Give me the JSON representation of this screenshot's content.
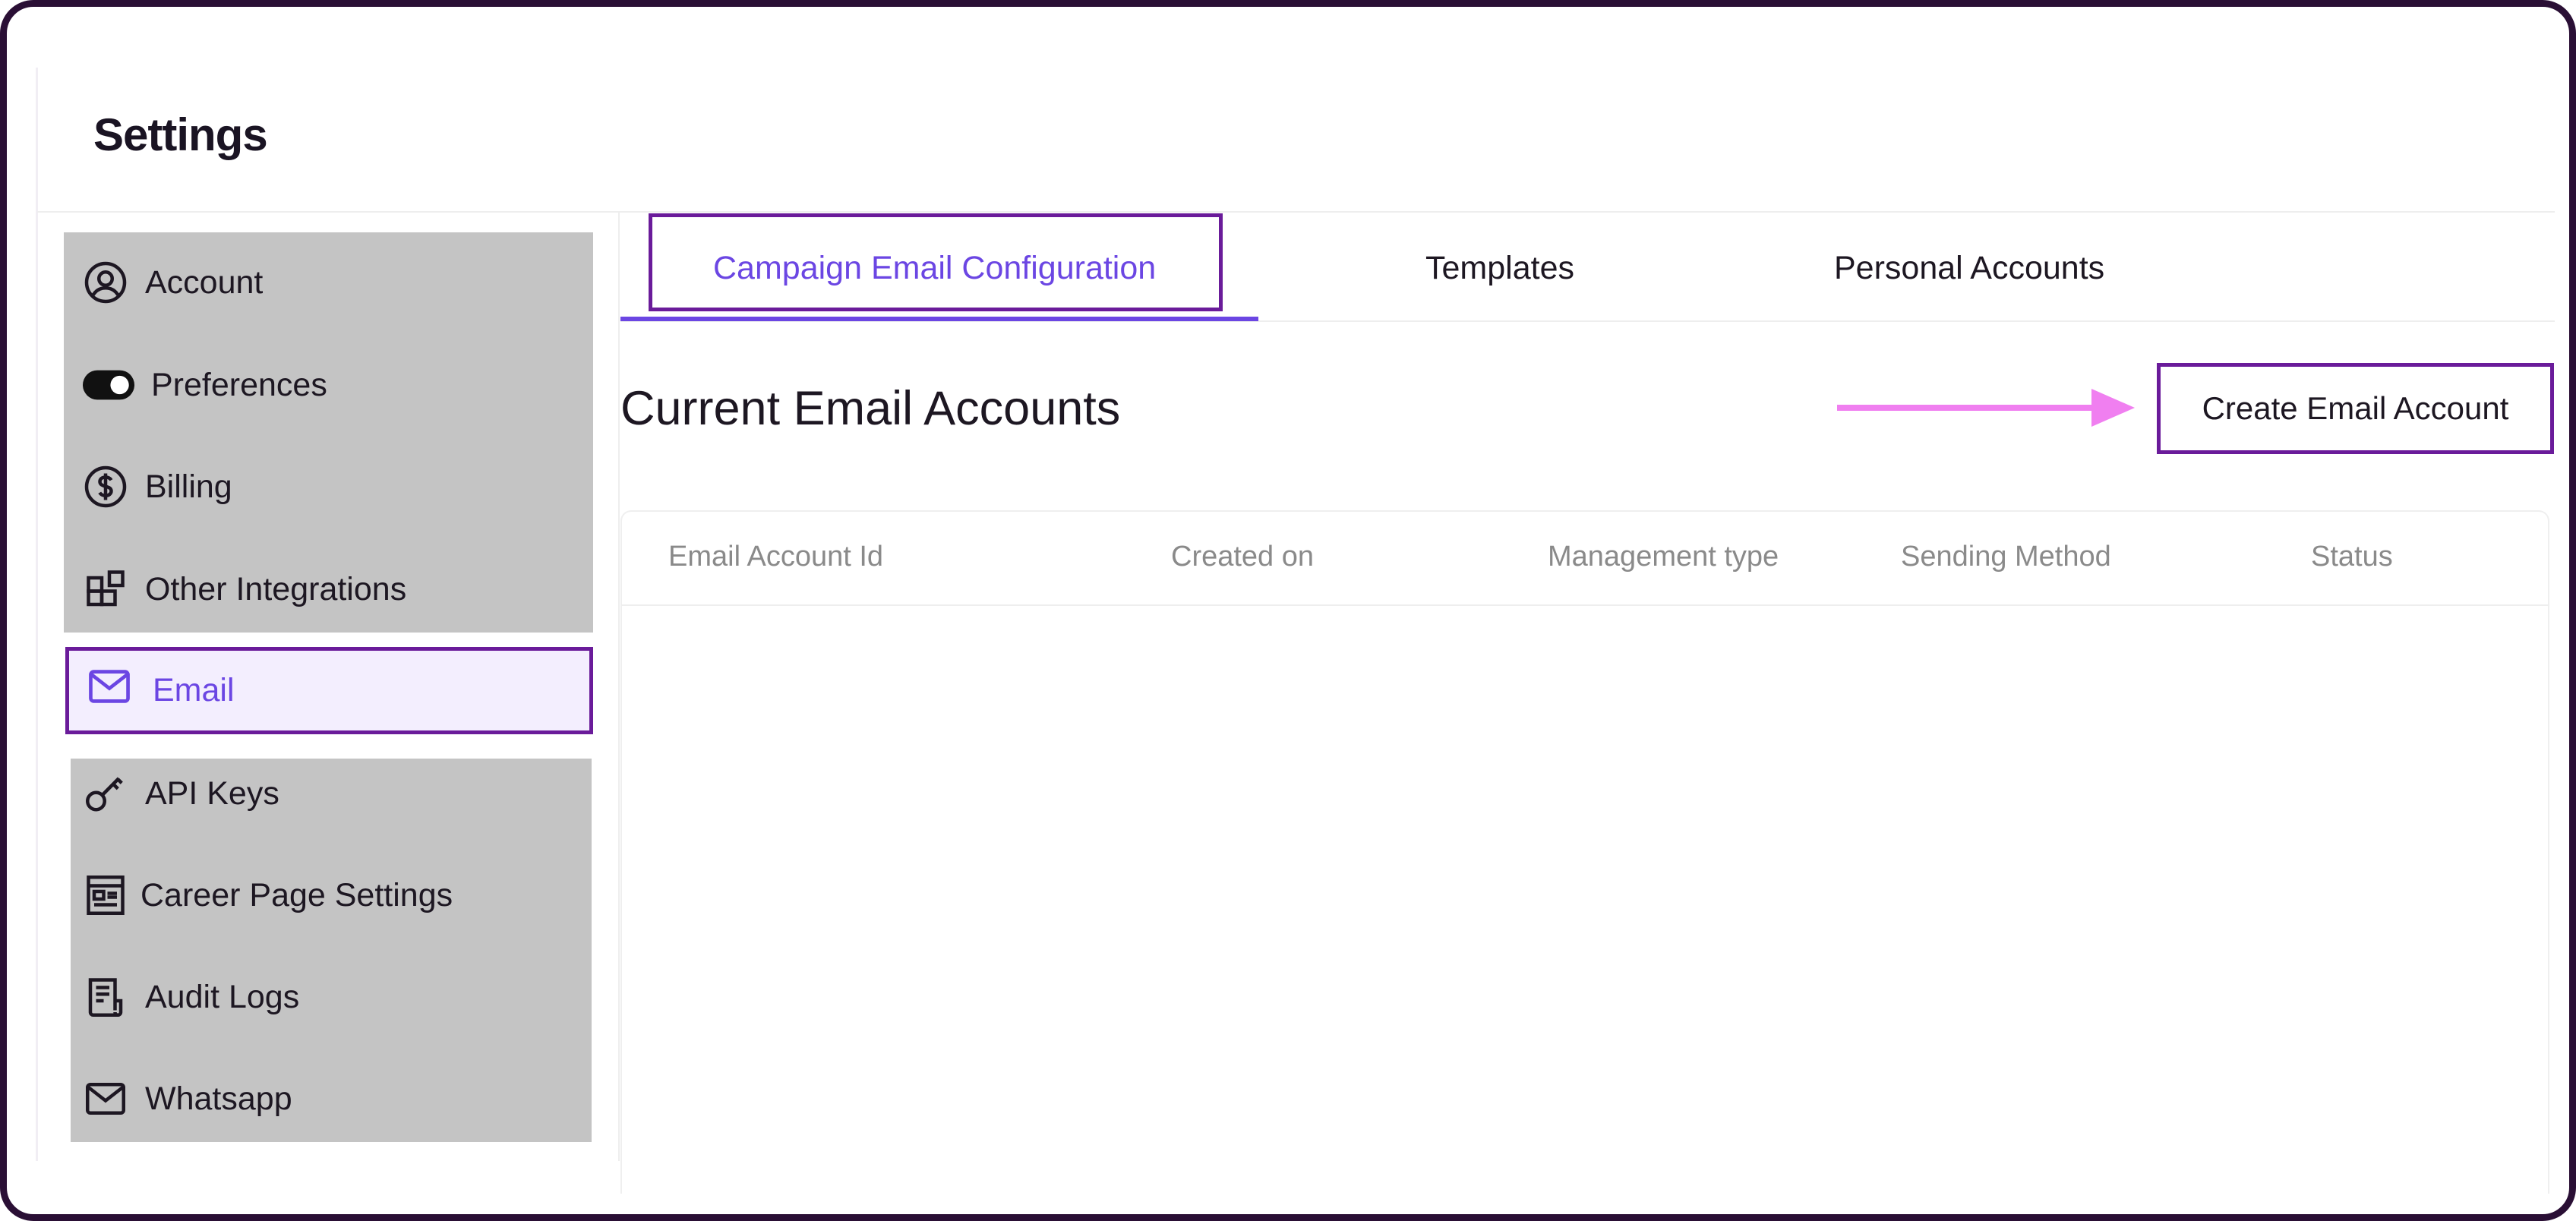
{
  "app": {
    "title": "Settings"
  },
  "sidebar": {
    "items": [
      {
        "label": "Account",
        "icon": "account-circle-icon"
      },
      {
        "label": "Preferences",
        "icon": "toggle-icon"
      },
      {
        "label": "Billing",
        "icon": "dollar-icon"
      },
      {
        "label": "Other Integrations",
        "icon": "integrations-icon"
      },
      {
        "label": "Email",
        "icon": "mail-icon",
        "active": true
      },
      {
        "label": "API Keys",
        "icon": "key-icon"
      },
      {
        "label": "Career Page Settings",
        "icon": "page-layout-icon"
      },
      {
        "label": "Audit Logs",
        "icon": "document-list-icon"
      },
      {
        "label": "Whatsapp",
        "icon": "mail-icon"
      }
    ]
  },
  "tabs": [
    {
      "label": "Campaign Email Configuration",
      "active": true
    },
    {
      "label": "Templates",
      "active": false
    },
    {
      "label": "Personal Accounts",
      "active": false
    }
  ],
  "main": {
    "section_title": "Current Email Accounts",
    "create_button_label": "Create Email Account",
    "table": {
      "columns": [
        "Email Account Id",
        "Created on",
        "Management type",
        "Sending Method",
        "Status"
      ],
      "rows": []
    }
  },
  "colors": {
    "accent": "#6b46e3",
    "highlight_border": "#6a1b9a",
    "annotation_arrow": "#f07ff0",
    "sidebar_group_bg": "#c4c4c4"
  }
}
